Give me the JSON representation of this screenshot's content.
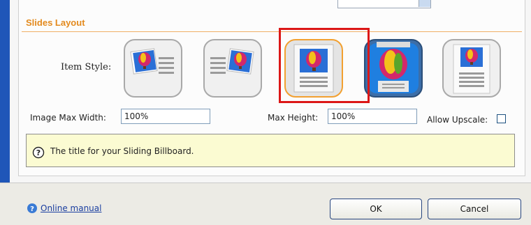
{
  "section": {
    "title": "Slides Layout"
  },
  "item_style": {
    "label": "Item Style:",
    "options": [
      {
        "name": "image-left-text-right",
        "selected": false
      },
      {
        "name": "text-left-image-right",
        "selected": false
      },
      {
        "name": "image-top-text-bottom",
        "selected": true
      },
      {
        "name": "fullbleed-image-caption",
        "selected": false
      },
      {
        "name": "image-top-text-list",
        "selected": false
      }
    ]
  },
  "image_max_width": {
    "label": "Image Max Width:",
    "value": "100%"
  },
  "max_height": {
    "label": "Max Height:",
    "value": "100%"
  },
  "allow_upscale": {
    "label": "Allow Upscale:",
    "checked": false
  },
  "help": {
    "icon": "question-circle-icon",
    "text": "The title for your Sliding Billboard."
  },
  "footer": {
    "manual_label": "Online manual",
    "ok_label": "OK",
    "cancel_label": "Cancel"
  },
  "colors": {
    "accent": "#e38a1e",
    "highlight": "#dc1717",
    "help_bg": "#fbfbd2",
    "sidebar": "#1f56b8"
  }
}
